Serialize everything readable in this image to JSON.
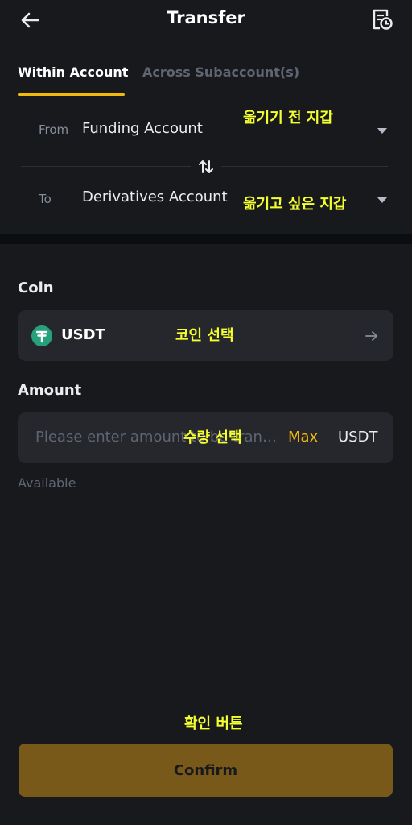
{
  "header": {
    "title": "Transfer",
    "back_icon": "arrow-left-icon",
    "history_icon": "history-icon"
  },
  "tabs": [
    {
      "label": "Within Account",
      "active": true
    },
    {
      "label": "Across Subaccount(s)",
      "active": false
    }
  ],
  "transfer": {
    "from_label": "From",
    "from_value": "Funding Account",
    "to_label": "To",
    "to_value": "Derivatives Account",
    "swap_icon": "swap-icon"
  },
  "annotations": {
    "from": "옮기기 전 지갑",
    "to": "옮기고 싶은 지갑",
    "coin": "코인 선택",
    "amount": "수량 선택",
    "confirm": "확인 버튼"
  },
  "coin": {
    "section_label": "Coin",
    "symbol": "USDT",
    "icon": "tether-icon"
  },
  "amount": {
    "section_label": "Amount",
    "placeholder": "Please enter amount to be transferred",
    "max_label": "Max",
    "unit": "USDT",
    "available_label": "Available"
  },
  "confirm_label": "Confirm",
  "colors": {
    "accent": "#f0b90b",
    "background": "#18191d",
    "annotation": "#f5ff2e",
    "usdt": "#26a17b"
  }
}
